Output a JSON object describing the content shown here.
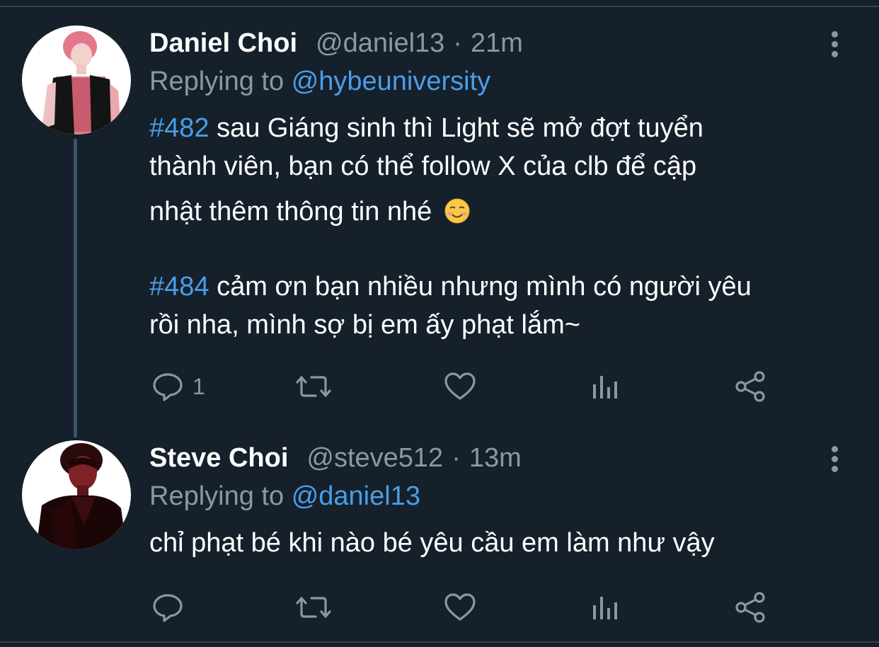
{
  "tweets": [
    {
      "name": "Daniel Choi",
      "handle": "@daniel13",
      "separator": "·",
      "time": "21m",
      "replying_prefix": "Replying to",
      "replying_to": "@hybeuniversity",
      "body": {
        "hashtag1": "#482",
        "line1_rest": " sau Giáng sinh thì Light sẽ mở đợt tuyển",
        "line2": "thành viên, bạn có thể follow X của clb để cập",
        "line3": "nhật thêm thông tin nhé",
        "emoji": "smiling-face-emoji",
        "hashtag2": "#484",
        "line4_rest": " cảm ơn bạn nhiều nhưng mình có người yêu",
        "line5": "rồi nha, mình sợ bị em ấy phạt lắm~"
      },
      "reply_count": "1"
    },
    {
      "name": "Steve Choi",
      "handle": "@steve512",
      "separator": "·",
      "time": "13m",
      "replying_prefix": "Replying to",
      "replying_to": "@daniel13",
      "body": {
        "line1": "chỉ phạt bé khi nào bé yêu cầu em làm như vậy"
      },
      "reply_count": ""
    }
  ],
  "icons": [
    "reply-icon",
    "retweet-icon",
    "like-icon",
    "analytics-icon",
    "share-icon",
    "more-options-icon"
  ],
  "colors": {
    "background": "#15202b",
    "text": "#ffffff",
    "muted": "#8899a6",
    "link": "#4a9ee8",
    "thread_line": "#3d5466"
  }
}
